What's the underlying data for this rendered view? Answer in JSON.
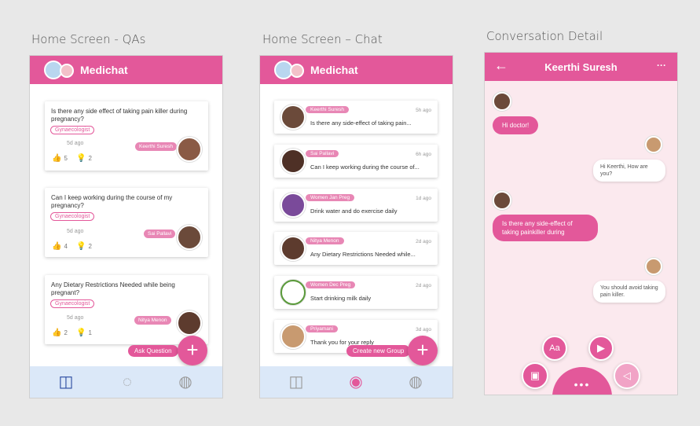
{
  "labels": {
    "qa": "Home Screen - QAs",
    "chat": "Home Screen – Chat",
    "conv": "Conversation Detail"
  },
  "app": {
    "title": "Medichat"
  },
  "qa_screen": {
    "fab_label": "Ask Question",
    "fab_icon": "+",
    "questions": [
      {
        "text": "Is there any side effect of taking pain killer during pregnancy?",
        "tag": "Gynaecologist",
        "ago": "5d ago",
        "author": "Keerthi Suresh",
        "likes": "5",
        "ideas": "2"
      },
      {
        "text": "Can I keep working during the course of my pregnancy?",
        "tag": "Gynaecologist",
        "ago": "5d ago",
        "author": "Sai Pallavi",
        "likes": "4",
        "ideas": "2"
      },
      {
        "text": "Any Dietary Restrictions Needed while being pregnant?",
        "tag": "Gynaecologist",
        "ago": "5d ago",
        "author": "Nitya Menon",
        "likes": "2",
        "ideas": "1"
      }
    ]
  },
  "chat_screen": {
    "fab_label": "Create new Group",
    "fab_icon": "+",
    "chats": [
      {
        "name": "Keerthi Suresh",
        "msg": "Is there any side-effect of taking pain...",
        "time": "5h ago"
      },
      {
        "name": "Sai Pallavi",
        "msg": "Can I keep working during the course of...",
        "time": "6h ago"
      },
      {
        "name": "Women Jan Preg",
        "msg": "Drink water and do exercise daily",
        "time": "1d ago"
      },
      {
        "name": "Nitya Menon",
        "msg": "Any Dietary Restrictions Needed while...",
        "time": "2d ago"
      },
      {
        "name": "Women Dec Preg",
        "msg": "Start drinking milk daily",
        "time": "2d ago"
      },
      {
        "name": "Priyamani",
        "msg": "Thank you for your reply",
        "time": "3d ago"
      }
    ]
  },
  "conversation": {
    "title": "Keerthi Suresh",
    "back_icon": "←",
    "more_icon": "···",
    "messages": [
      {
        "from": "in",
        "text": "Hi doctor!"
      },
      {
        "from": "out",
        "text": "Hi Keerthi, How are you?"
      },
      {
        "from": "in",
        "text": "Is there any side-effect of taking painkiller during"
      },
      {
        "from": "out",
        "text": "You should avoid taking pain killer."
      }
    ],
    "actions": {
      "text": "Aa",
      "menu": "•••"
    }
  },
  "colors": {
    "accent": "#e3589a",
    "light_pink": "#fbe9ee",
    "tabbar": "#dbe8f8"
  }
}
